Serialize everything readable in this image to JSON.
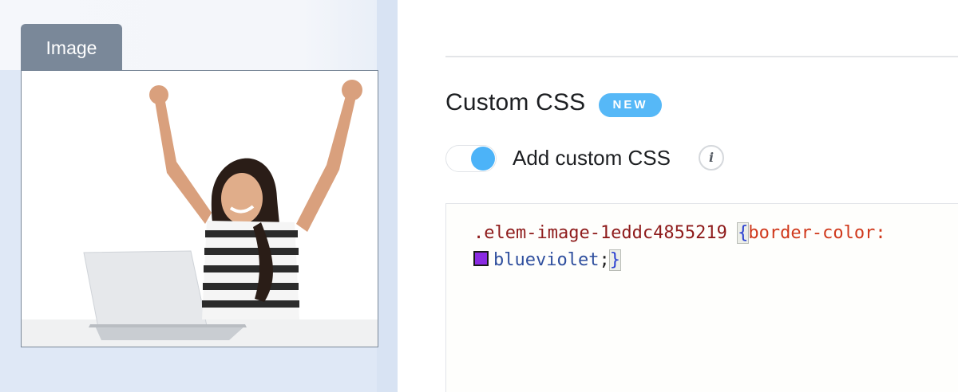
{
  "canvas": {
    "element_tab_label": "Image",
    "image_alt": "Woman raising arms in celebration at laptop"
  },
  "settings": {
    "section_title": "Custom CSS",
    "badge": "NEW",
    "toggle": {
      "label": "Add custom CSS",
      "checked": true
    },
    "info_icon": "info-icon",
    "info_glyph": "i",
    "code": {
      "selector": ".elem-image-1eddc4855219",
      "open_brace": "{",
      "property": "border-color:",
      "value": "blueviolet",
      "semicolon": ";",
      "close_brace": "}",
      "swatch_color": "#8a2be2"
    }
  },
  "colors": {
    "accent": "#56b8f7",
    "toggle_on": "#4cb3f8",
    "tab_bg": "#7a8899"
  }
}
